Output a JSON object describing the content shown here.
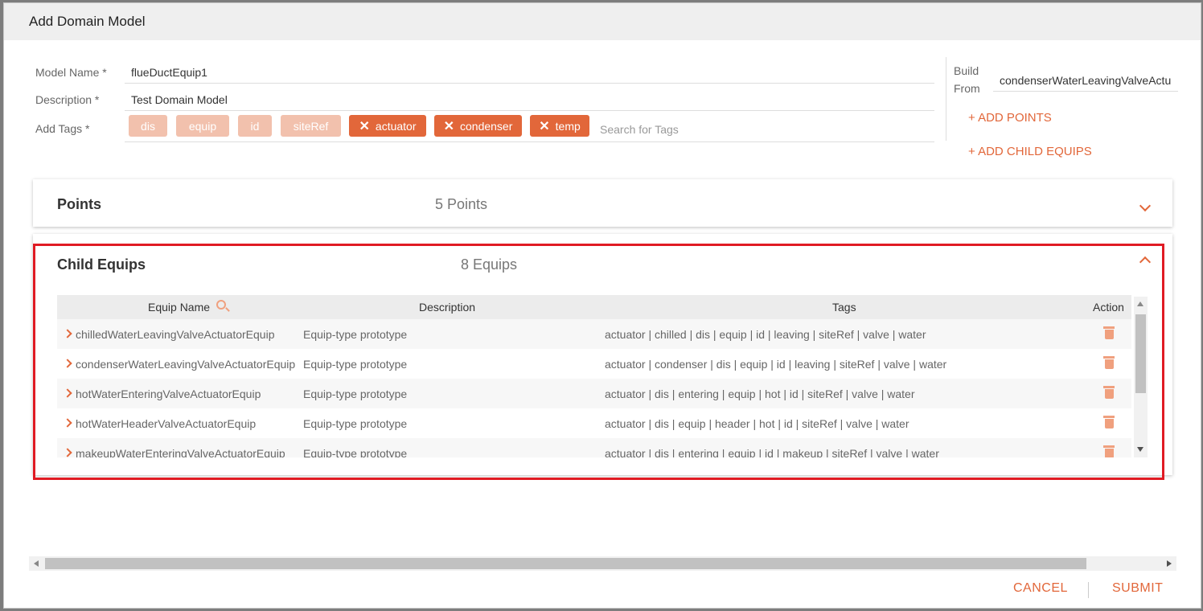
{
  "dialog": {
    "title": "Add Domain Model"
  },
  "form": {
    "model_name_label": "Model Name *",
    "model_name_value": "flueDuctEquip1",
    "description_label": "Description *",
    "description_value": "Test Domain Model",
    "tags_label": "Add Tags *",
    "tags_placeholder": "Search for Tags",
    "fixed_tags": [
      "dis",
      "equip",
      "id",
      "siteRef"
    ],
    "removable_tags": [
      "actuator",
      "condenser",
      "temp"
    ]
  },
  "build": {
    "label_line1": "Build",
    "label_line2": "From",
    "value": "condenserWaterLeavingValveActu",
    "add_points": "+ ADD POINTS",
    "add_child_equips": "+ ADD CHILD EQUIPS"
  },
  "points_panel": {
    "title": "Points",
    "count": "5 Points",
    "expanded": false
  },
  "child_panel": {
    "title": "Child Equips",
    "count": "8 Equips",
    "expanded": true,
    "columns": [
      "Equip Name",
      "Description",
      "Tags",
      "Action"
    ],
    "rows": [
      {
        "name": "chilledWaterLeavingValveActuatorEquip",
        "description": "Equip-type prototype",
        "tags": "actuator | chilled | dis | equip | id | leaving | siteRef | valve | water"
      },
      {
        "name": "condenserWaterLeavingValveActuatorEquip",
        "description": "Equip-type prototype",
        "tags": "actuator | condenser | dis | equip | id | leaving | siteRef | valve | water"
      },
      {
        "name": "hotWaterEnteringValveActuatorEquip",
        "description": "Equip-type prototype",
        "tags": "actuator | dis | entering | equip | hot | id | siteRef | valve | water"
      },
      {
        "name": "hotWaterHeaderValveActuatorEquip",
        "description": "Equip-type prototype",
        "tags": "actuator | dis | equip | header | hot | id | siteRef | valve | water"
      },
      {
        "name": "makeupWaterEnteringValveActuatorEquip",
        "description": "Equip-type prototype",
        "tags": "actuator | dis | entering | equip | id | makeup | siteRef | valve | water"
      }
    ]
  },
  "footer": {
    "cancel": "CANCEL",
    "submit": "SUBMIT"
  },
  "colors": {
    "accent": "#e2673a",
    "tag_light": "#f2c1ad",
    "highlight": "#e01b24"
  }
}
